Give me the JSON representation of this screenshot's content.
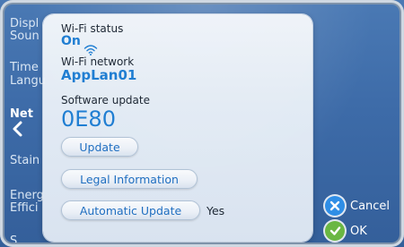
{
  "menu": {
    "items": [
      {
        "label": "Displ"
      },
      {
        "label": "Soun"
      },
      {
        "label": "Time"
      },
      {
        "label": "Langu"
      },
      {
        "label": "Net"
      },
      {
        "label": "Stain"
      },
      {
        "label": "Energ"
      },
      {
        "label": "Effici"
      },
      {
        "label": "S"
      }
    ]
  },
  "panel": {
    "wifi_status_label": "Wi-Fi status",
    "wifi_status_value": "On",
    "wifi_network_label": "Wi-Fi network",
    "wifi_network_value": "AppLan01",
    "software_update_label": "Software update",
    "software_version": "0E80",
    "update_button": "Update",
    "legal_button": "Legal Information",
    "auto_update_button": "Automatic Update",
    "auto_update_value": "Yes"
  },
  "actions": {
    "cancel_label": "Cancel",
    "ok_label": "OK"
  },
  "colors": {
    "accent": "#1f7fd4",
    "background": "#3d6ba8",
    "ok_green": "#6ab743",
    "cancel_blue": "#2f8ee6"
  }
}
